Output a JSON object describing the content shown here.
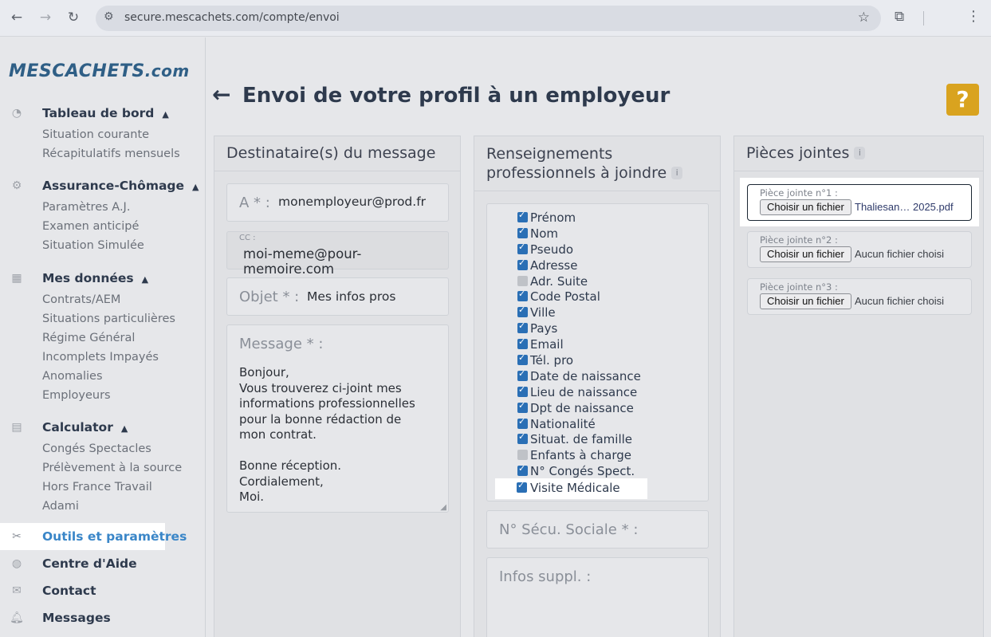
{
  "browser": {
    "url": "secure.mescachets.com/compte/envoi"
  },
  "logo": {
    "text": "MESCACHETS",
    "suffix": ".com"
  },
  "sidebar": {
    "sections": [
      {
        "title": "Tableau de bord",
        "items": [
          "Situation courante",
          "Récapitulatifs mensuels"
        ]
      },
      {
        "title": "Assurance-Chômage",
        "items": [
          "Paramètres A.J.",
          "Examen anticipé",
          "Situation Simulée"
        ]
      },
      {
        "title": "Mes données",
        "items": [
          "Contrats/AEM",
          "Situations particulières",
          "Régime Général",
          "Incomplets Impayés",
          "Anomalies",
          "Employeurs"
        ]
      },
      {
        "title": "Calculator",
        "items": [
          "Congés Spectacles",
          "Prélèvement à la source",
          "Hors France Travail",
          "Adami"
        ]
      }
    ],
    "links": [
      "Outils et paramètres",
      "Centre d'Aide",
      "Contact",
      "Messages"
    ]
  },
  "page": {
    "title": "Envoi de votre profil à un employeur",
    "help": "?"
  },
  "recipients": {
    "header": "Destinataire(s) du message",
    "to_label": "A * :",
    "to_value": "monemployeur@prod.fr",
    "cc_label": "CC :",
    "cc_value": "moi-meme@pour-memoire.com",
    "subject_label": "Objet * :",
    "subject_value": "Mes infos pros",
    "message_label": "Message * :",
    "message_lines": [
      "Bonjour,",
      "Vous trouverez ci-joint mes",
      "informations professionnelles",
      "pour la bonne rédaction de",
      "mon contrat.",
      "",
      "Bonne réception.",
      "Cordialement,",
      "Moi."
    ]
  },
  "renseignements": {
    "header_line1": "Renseignements",
    "header_line2": "professionnels à joindre",
    "fields": [
      {
        "label": "Prénom",
        "checked": true
      },
      {
        "label": "Nom",
        "checked": true
      },
      {
        "label": "Pseudo",
        "checked": true
      },
      {
        "label": "Adresse",
        "checked": true
      },
      {
        "label": "Adr. Suite",
        "checked": false
      },
      {
        "label": "Code Postal",
        "checked": true
      },
      {
        "label": "Ville",
        "checked": true
      },
      {
        "label": "Pays",
        "checked": true
      },
      {
        "label": "Email",
        "checked": true
      },
      {
        "label": "Tél. pro",
        "checked": true
      },
      {
        "label": "Date de naissance",
        "checked": true
      },
      {
        "label": "Lieu de naissance",
        "checked": true
      },
      {
        "label": "Dpt de naissance",
        "checked": true
      },
      {
        "label": "Nationalité",
        "checked": true
      },
      {
        "label": "Situat. de famille",
        "checked": true
      },
      {
        "label": "Enfants à charge",
        "checked": false
      },
      {
        "label": "N° Congés Spect.",
        "checked": true
      },
      {
        "label": "Visite Médicale",
        "checked": true
      }
    ],
    "secu_label": "N° Sécu. Sociale * :",
    "infos_label": "Infos suppl. :"
  },
  "attachments": {
    "header": "Pièces jointes",
    "items": [
      {
        "label": "Pièce jointe n°1 :",
        "button": "Choisir un fichier",
        "file": "Thaliesan… 2025.pdf"
      },
      {
        "label": "Pièce jointe n°2 :",
        "button": "Choisir un fichier",
        "file": "Aucun fichier choisi"
      },
      {
        "label": "Pièce jointe n°3 :",
        "button": "Choisir un fichier",
        "file": "Aucun fichier choisi"
      }
    ]
  }
}
